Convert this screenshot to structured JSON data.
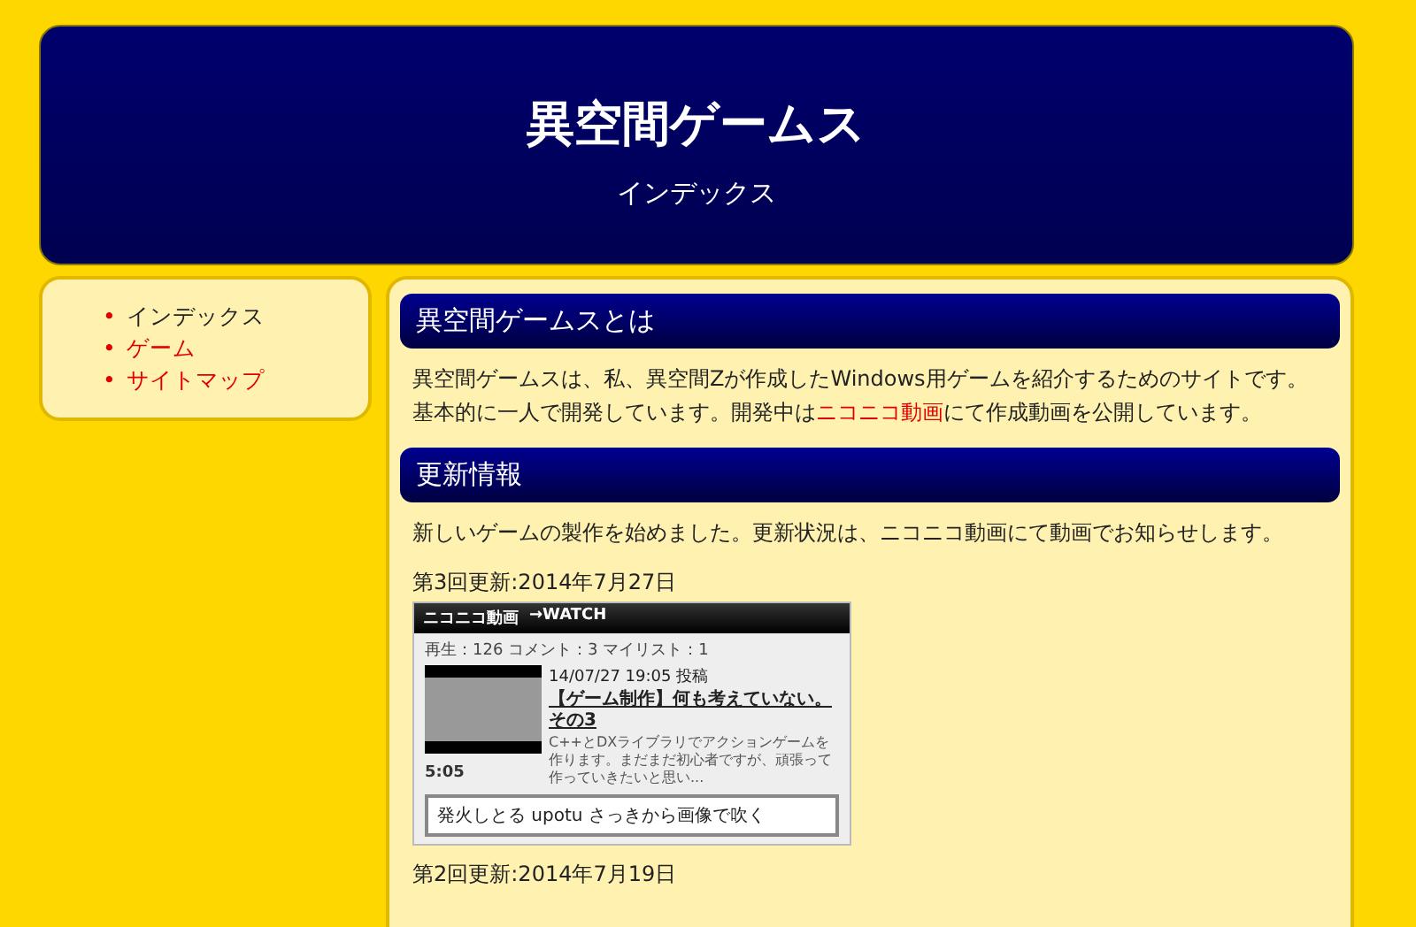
{
  "header": {
    "title": "異空間ゲームス",
    "subtitle": "インデックス"
  },
  "nav": [
    {
      "bullet": "•",
      "label": "インデックス",
      "selected": true
    },
    {
      "bullet": "•",
      "label": "ゲーム",
      "selected": false
    },
    {
      "bullet": "•",
      "label": "サイトマップ",
      "selected": false
    }
  ],
  "about": {
    "heading": "異空間ゲームスとは",
    "before": "異空間ゲームスは、私、異空間Zが作成したWindows用ゲームを紹介するためのサイトです。基本的に一人で開発しています。開発中は",
    "link": "ニコニコ動画",
    "after": "にて作成動画を公開しています。"
  },
  "news": {
    "heading": "更新情報",
    "intro": "新しいゲームの製作を始めました。更新状況は、ニコニコ動画にて動画でお知らせします。",
    "updates": [
      {
        "date": "第3回更新:2014年7月27日",
        "video": {
          "logo": "ニコニコ動画",
          "watch": "→WATCH",
          "stats": "再生：126 コメント：3 マイリスト：1",
          "posted": "14/07/27 19:05 投稿",
          "title": "【ゲーム制作】何も考えていない。その3",
          "description": "C++とDXライブラリでアクションゲームを作ります。まだまだ初心者ですが、頑張って作っていきたいと思い...",
          "duration": "5:05",
          "comment": "発火しとる upotu さっきから画像で吹く"
        }
      },
      {
        "date": "第2回更新:2014年7月19日"
      }
    ]
  }
}
